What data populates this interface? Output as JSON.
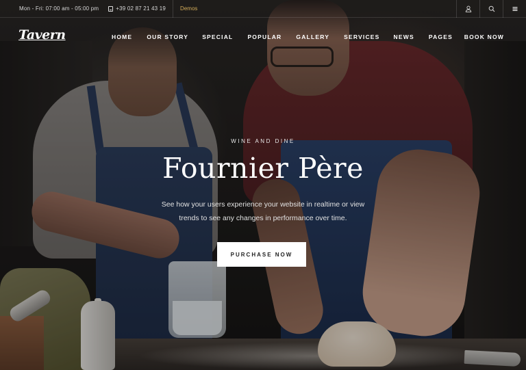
{
  "topbar": {
    "hours": "Mon - Fri: 07:00 am - 05:00 pm",
    "phone": "+39 02 87 21 43 19",
    "demos": "Demos",
    "icons": [
      "user-icon",
      "search-icon",
      "menu-icon"
    ],
    "accent_color": "#d5ad5a"
  },
  "nav": {
    "logo": "Tavern",
    "items": [
      "HOME",
      "OUR STORY",
      "SPECIAL",
      "POPULAR",
      "GALLERY",
      "SERVICES",
      "NEWS",
      "PAGES"
    ],
    "cta": "BOOK NOW"
  },
  "hero": {
    "eyebrow": "WINE AND DINE",
    "title": "Fournier Père",
    "description_line1": "See how your users experience your website in realtime or view",
    "description_line2": "trends to see any changes in performance over time.",
    "button": "PURCHASE NOW"
  }
}
